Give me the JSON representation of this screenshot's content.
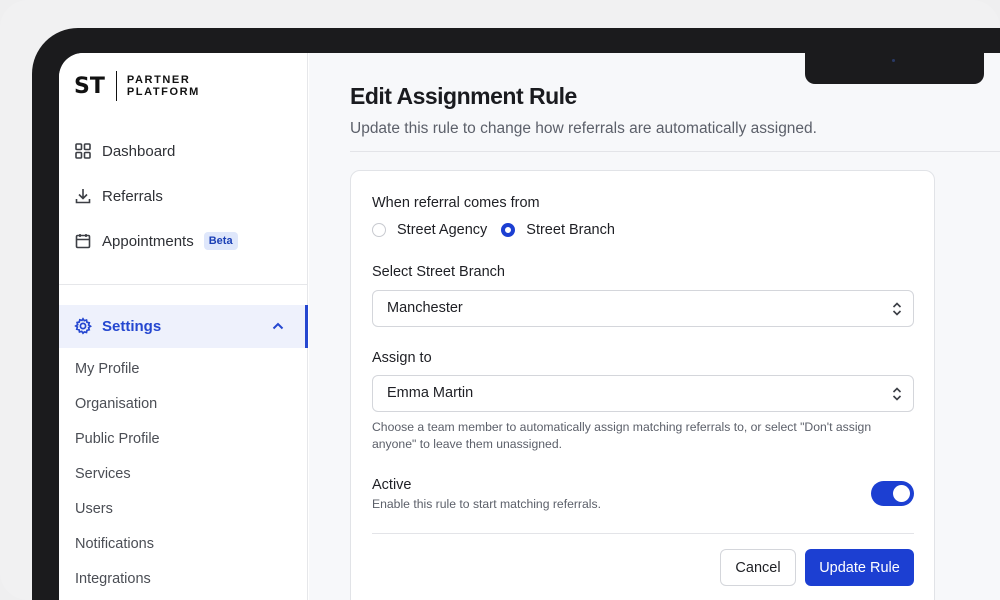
{
  "brand": {
    "mark": "ST",
    "line1": "PARTNER",
    "line2": "PLATFORM"
  },
  "sidebar": {
    "items": [
      {
        "label": "Dashboard",
        "icon": "grid-icon"
      },
      {
        "label": "Referrals",
        "icon": "download-icon"
      },
      {
        "label": "Appointments",
        "icon": "calendar-icon",
        "badge": "Beta"
      }
    ],
    "settings": {
      "label": "Settings",
      "icon": "gear-icon",
      "expanded": true
    },
    "settings_items": [
      "My Profile",
      "Organisation",
      "Public Profile",
      "Services",
      "Users",
      "Notifications",
      "Integrations"
    ]
  },
  "page": {
    "title": "Edit Assignment Rule",
    "subtitle": "Update this rule to change how referrals are automatically assigned."
  },
  "form": {
    "source_label": "When referral comes from",
    "source_options": [
      {
        "label": "Street Agency",
        "selected": false
      },
      {
        "label": "Street Branch",
        "selected": true
      }
    ],
    "branch_label": "Select Street Branch",
    "branch_value": "Manchester",
    "assign_label": "Assign to",
    "assign_value": "Emma Martin",
    "assign_help": "Choose a team member to automatically assign matching referrals to, or select \"Don't assign anyone\" to leave them unassigned.",
    "active_label": "Active",
    "active_desc": "Enable this rule to start matching referrals.",
    "active_on": true,
    "cancel_label": "Cancel",
    "submit_label": "Update Rule"
  },
  "colors": {
    "accent": "#1c3fd2",
    "nav_active_bg": "#eef1fc"
  }
}
